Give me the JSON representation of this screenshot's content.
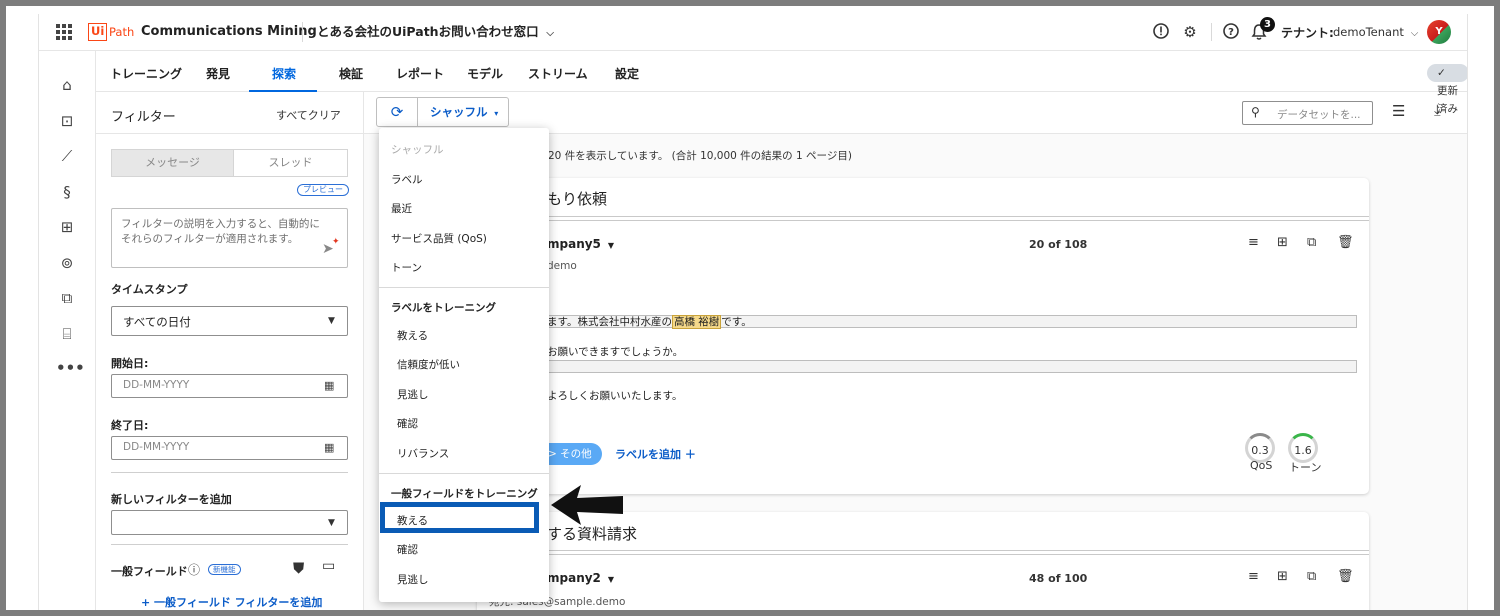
{
  "topbar": {
    "logo_box": "Ui",
    "logo_path": "Path",
    "product": "Communications Mining",
    "dataset": "とある会社のUiPathお問い合わせ窓口",
    "notification_count": "3",
    "tenant_label": "テナント:",
    "tenant_value": "demoTenant",
    "avatar_letter": "Y"
  },
  "tabs": [
    "トレーニング",
    "発見",
    "探索",
    "検証",
    "レポート",
    "モデル",
    "ストリーム",
    "設定"
  ],
  "active_tab": "探索",
  "updated_label": "✓ 更新済み",
  "filters": {
    "title": "フィルター",
    "clear_all": "すべてクリア",
    "seg_message": "メッセージ",
    "seg_thread": "スレッド",
    "preview_badge": "プレビュー",
    "desc_placeholder": "フィルターの説明を入力すると、自動的にそれらのフィルターが適用されます。",
    "timestamp_label": "タイムスタンプ",
    "timestamp_value": "すべての日付",
    "start_label": "開始日:",
    "start_placeholder": "DD-MM-YYYY",
    "end_label": "終了日:",
    "end_placeholder": "DD-MM-YYYY",
    "new_filter_label": "新しいフィルターを追加",
    "general_field_label": "一般フィールド",
    "new_feature_badge": "新機能",
    "add_general_filter": "+ 一般フィールド フィルターを追加"
  },
  "main": {
    "shuffle_label": "シャッフル",
    "search_placeholder": "データセットを...",
    "info_text": "20 件を表示しています。 (合計 10,000 件の結果の 1 ページ目)",
    "card1": {
      "title": "もり依頼",
      "sender": "mpany5",
      "counter": "20 of 108",
      "to_fragment": "demo",
      "line1_pre": "ます。株式会社中村水産の",
      "line1_highlight": "高橋 裕樹",
      "line1_post": "です。",
      "line2": "お願いできますでしょうか。",
      "line3": "よろしくお願いいたします。",
      "chip_label": "> その他",
      "add_label": "ラベルを追加 ＋",
      "qos_value": "0.3",
      "qos_label": "QoS",
      "tone_value": "1.6",
      "tone_label": "トーン"
    },
    "card2": {
      "title": "する資料請求",
      "sender": "mpany2",
      "counter": "48 of 100",
      "to_line": "宛先: sales@sample.demo"
    }
  },
  "dropdown": {
    "items": [
      {
        "label": "シャッフル",
        "kind": "disabled"
      },
      {
        "label": "ラベル",
        "kind": "item"
      },
      {
        "label": "最近",
        "kind": "item"
      },
      {
        "label": "サービス品質 (QoS)",
        "kind": "item"
      },
      {
        "label": "トーン",
        "kind": "item"
      },
      {
        "label": "ラベルをトレーニング",
        "kind": "header"
      },
      {
        "label": "教える",
        "kind": "sub"
      },
      {
        "label": "信頼度が低い",
        "kind": "sub"
      },
      {
        "label": "見逃し",
        "kind": "sub"
      },
      {
        "label": "確認",
        "kind": "sub"
      },
      {
        "label": "リバランス",
        "kind": "sub"
      },
      {
        "label": "一般フィールドをトレーニング",
        "kind": "header"
      },
      {
        "label": "教える",
        "kind": "sub"
      },
      {
        "label": "確認",
        "kind": "sub"
      },
      {
        "label": "見逃し",
        "kind": "sub"
      }
    ]
  },
  "colors": {
    "brand": "#fa4616",
    "accent": "#0067df",
    "highlight_box": "#0a5bb5"
  }
}
